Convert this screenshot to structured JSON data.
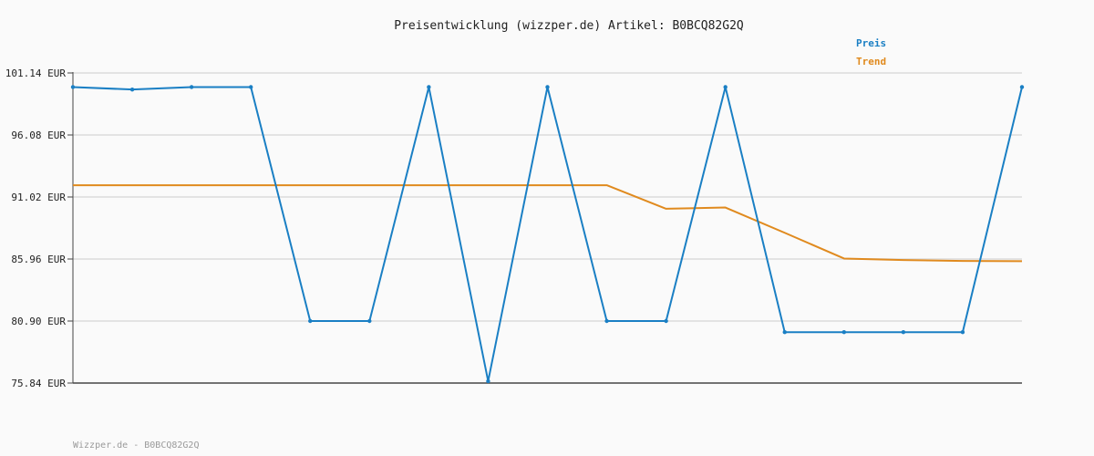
{
  "chart_data": {
    "type": "line",
    "title": "Preisentwicklung (wizzper.de) Artikel: B0BCQ82G2Q",
    "ylim": [
      75.84,
      101.14
    ],
    "y_ticks": [
      "101.14 EUR",
      "96.08 EUR",
      "91.02 EUR",
      "85.96 EUR",
      "80.90 EUR",
      "75.84 EUR"
    ],
    "y_tick_values": [
      101.14,
      96.08,
      91.02,
      85.96,
      80.9,
      75.84
    ],
    "grid": true,
    "legend_position": "top-right",
    "x": [
      0,
      1,
      2,
      3,
      4,
      5,
      6,
      7,
      8,
      9,
      10,
      11,
      12,
      13,
      14,
      15,
      16
    ],
    "series": [
      {
        "name": "Preis",
        "color": "#1a7fc4",
        "markers": true,
        "values": [
          99.99,
          99.79,
          99.99,
          99.99,
          80.9,
          80.9,
          99.99,
          75.99,
          99.99,
          80.9,
          80.9,
          99.99,
          79.99,
          79.99,
          79.99,
          79.99,
          99.99
        ]
      },
      {
        "name": "Trend",
        "color": "#e08a1e",
        "markers": false,
        "values": [
          91.98,
          91.98,
          91.98,
          91.98,
          91.98,
          91.98,
          91.98,
          91.98,
          91.98,
          91.98,
          90.06,
          90.16,
          88.1,
          86.0,
          85.88,
          85.8,
          85.78
        ]
      }
    ]
  },
  "footer": "Wizzper.de - B0BCQ82G2Q"
}
